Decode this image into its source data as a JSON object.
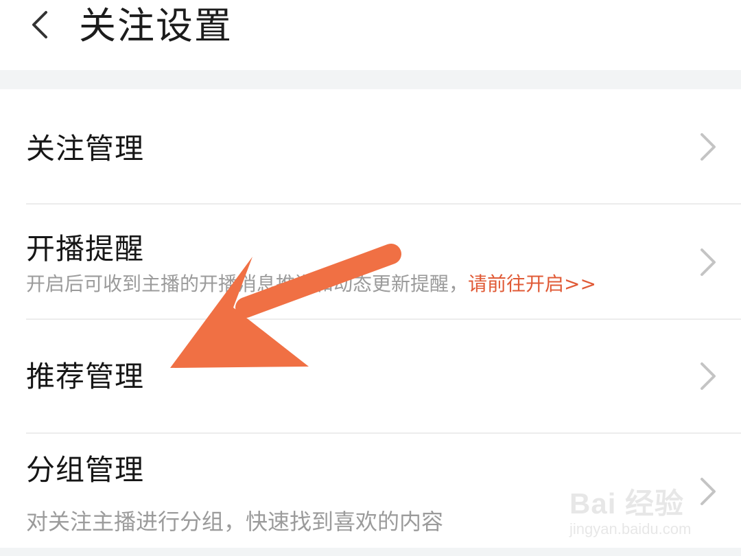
{
  "header": {
    "title": "关注设置",
    "back_icon": "chevron-left-icon"
  },
  "list": {
    "items": [
      {
        "label": "关注管理",
        "icon": "chevron-right-icon"
      },
      {
        "label": "开播提醒",
        "description": "开启后可收到主播的开播消息推送和动态更新提醒，",
        "link_text": "请前往开启>>",
        "icon": "chevron-right-icon"
      },
      {
        "label": "推荐管理",
        "icon": "chevron-right-icon"
      },
      {
        "label": "分组管理",
        "description": "对关注主播进行分组，快速找到喜欢的内容",
        "icon": "chevron-right-icon"
      }
    ]
  },
  "colors": {
    "link": "#e05a36",
    "annotation_arrow": "#f07044",
    "band": "#f2f4f5",
    "chevron": "#c4c4c4"
  },
  "watermark": {
    "brand": "Bai 经验",
    "url": "jingyan.baidu.com"
  }
}
